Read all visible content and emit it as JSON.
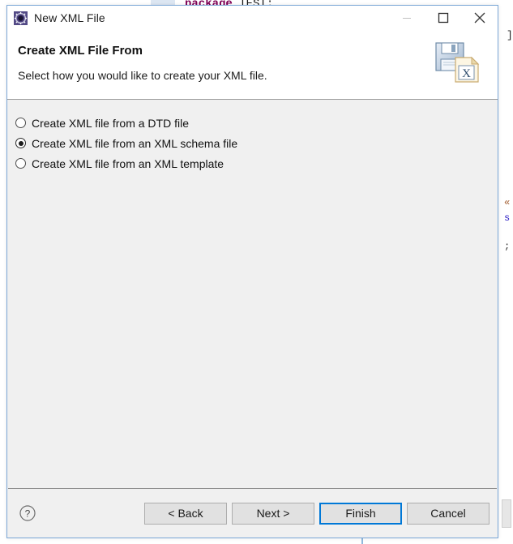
{
  "backdrop": {
    "code_package": "package",
    "code_package_rest": " TEST;",
    "code_bracket": "]",
    "code_fragment_1": "«",
    "code_fragment_2": "s",
    "code_fragment_3": ";",
    "editor_scrollbar": "editor-scrollbar"
  },
  "dialog": {
    "titlebar": {
      "icon": "xml-wizard-icon",
      "title": "New XML File",
      "minimize_label": "–",
      "maximize_label": "□",
      "close_label": "✕"
    },
    "header": {
      "title": "Create XML File From",
      "description": "Select how you would like to create your XML file.",
      "banner_icon": "save-xml-file-icon"
    },
    "body": {
      "options": [
        {
          "label": "Create XML file from a DTD file",
          "selected": false
        },
        {
          "label": "Create XML file from an XML schema file",
          "selected": true
        },
        {
          "label": "Create XML file from an XML template",
          "selected": false
        }
      ]
    },
    "footer": {
      "help_icon": "question-mark-icon",
      "back_label": "< Back",
      "next_label": "Next >",
      "finish_label": "Finish",
      "cancel_label": "Cancel"
    }
  },
  "colors": {
    "accent_focus": "#0078d7",
    "dialog_border": "#7ba7d7",
    "body_background": "#f0f0f0",
    "titlebar_background": "#ffffff",
    "button_face": "#e1e1e1",
    "keyword_purple": "#7f0055"
  }
}
